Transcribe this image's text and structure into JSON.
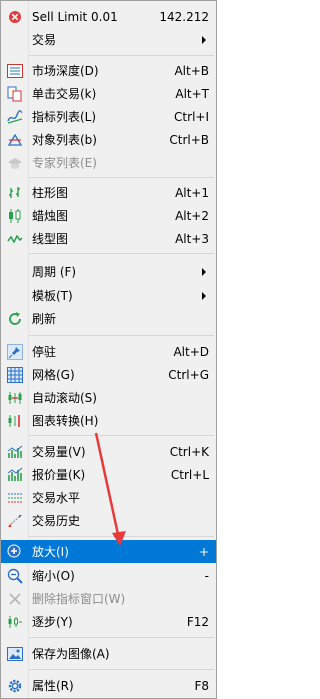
{
  "header": {
    "label": "Sell Limit 0.01",
    "value": "142.212"
  },
  "items": {
    "trade": "交易",
    "depth": "市场深度(D)",
    "depth_sc": "Alt+B",
    "one_click": "单击交易(k)",
    "one_click_sc": "Alt+T",
    "indicators": "指标列表(L)",
    "indicators_sc": "Ctrl+I",
    "objects": "对象列表(b)",
    "objects_sc": "Ctrl+B",
    "experts": "专家列表(E)",
    "bars": "柱形图",
    "bars_sc": "Alt+1",
    "candles": "蜡烛图",
    "candles_sc": "Alt+2",
    "line": "线型图",
    "line_sc": "Alt+3",
    "period": "周期  (F)",
    "template": "模板(T)",
    "refresh": "刷新",
    "dock": "停驻",
    "dock_sc": "Alt+D",
    "grid": "网格(G)",
    "grid_sc": "Ctrl+G",
    "autoscroll": "自动滚动(S)",
    "shift": "图表转换(H)",
    "volume": "交易量(V)",
    "volume_sc": "Ctrl+K",
    "ask": "报价量(K)",
    "ask_sc": "Ctrl+L",
    "trade_levels": "交易水平",
    "trade_history": "交易历史",
    "zoom_in": "放大(I)",
    "zoom_in_sc": "+",
    "zoom_out": "缩小(O)",
    "zoom_out_sc": "-",
    "delete_indicator": "删除指标窗口(W)",
    "step": "逐步(Y)",
    "step_sc": "F12",
    "save_image": "保存为图像(A)",
    "properties": "属性(R)",
    "properties_sc": "F8"
  }
}
